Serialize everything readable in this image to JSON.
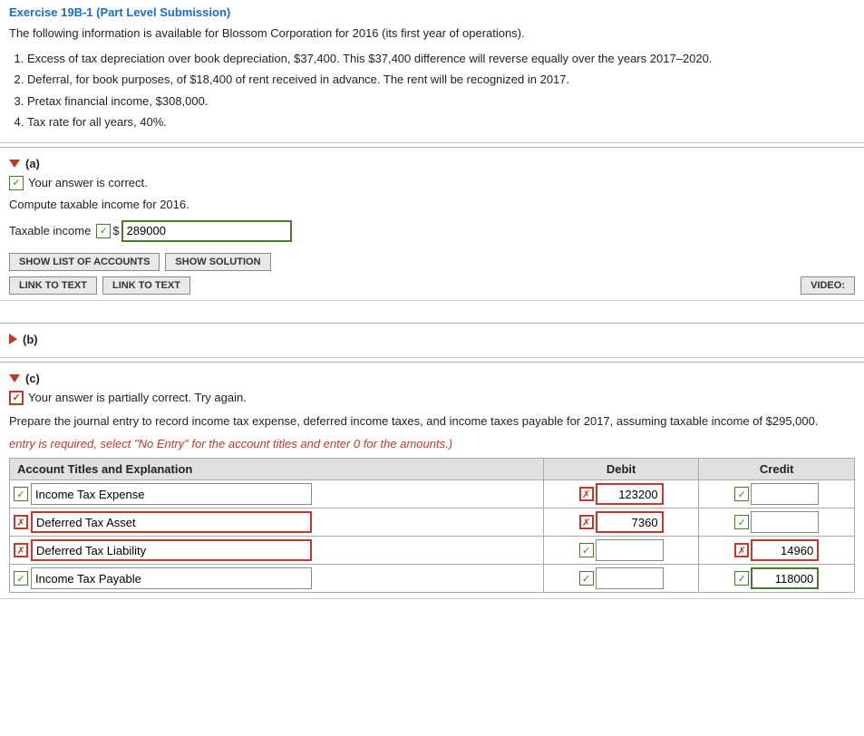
{
  "header": {
    "title": "Exercise 19B-1 (Part Level Submission)",
    "intro": "The following information is available for Blossom Corporation for 2016 (its first year of operations).",
    "items": [
      "Excess of tax depreciation over book depreciation, $37,400. This $37,400 difference will reverse equally over the years 2017–2020.",
      "Deferral, for book purposes, of $18,400 of rent received in advance. The rent will be recognized in 2017.",
      "Pretax financial income, $308,000.",
      "Tax rate for all years, 40%."
    ]
  },
  "section_a": {
    "label": "(a)",
    "correct_msg": "Your answer is correct.",
    "compute_label": "Compute taxable income for 2016.",
    "taxable_income_label": "Taxable income",
    "dollar_sign": "$",
    "taxable_income_value": "289000",
    "buttons": {
      "show_list": "SHOW LIST OF ACCOUNTS",
      "show_solution": "SHOW SOLUTION",
      "link_text1": "LINK TO TEXT",
      "link_text2": "LINK TO TEXT",
      "video": "VIDEO:"
    }
  },
  "section_b": {
    "label": "(b)"
  },
  "section_c": {
    "label": "(c)",
    "partial_msg": "Your answer is partially correct.  Try again.",
    "prepare_text": "Prepare the journal entry to record income tax expense, deferred income taxes, and income taxes payable for 2017, assuming taxable income of $295,000.",
    "italic_note": "entry is required, select \"No Entry\" for the account titles and enter 0 for the amounts.)",
    "table": {
      "col_account": "Account Titles and Explanation",
      "col_debit": "Debit",
      "col_credit": "Credit",
      "rows": [
        {
          "account_value": "Income Tax Expense",
          "account_check": "green",
          "debit_value": "123200",
          "debit_check": "red",
          "credit_value": "",
          "credit_check": "green",
          "row_check": "green"
        },
        {
          "account_value": "Deferred Tax Asset",
          "account_check": "red",
          "debit_value": "7360",
          "debit_check": "red",
          "credit_value": "",
          "credit_check": "green",
          "row_check": "red"
        },
        {
          "account_value": "Deferred Tax Liability",
          "account_check": "red",
          "debit_value": "",
          "debit_check": "green",
          "credit_value": "14960",
          "credit_check": "red",
          "row_check": "red"
        },
        {
          "account_value": "Income Tax Payable",
          "account_check": "green",
          "debit_value": "",
          "debit_check": "green",
          "credit_value": "118000",
          "credit_check": "green",
          "row_check": "green"
        }
      ]
    }
  }
}
